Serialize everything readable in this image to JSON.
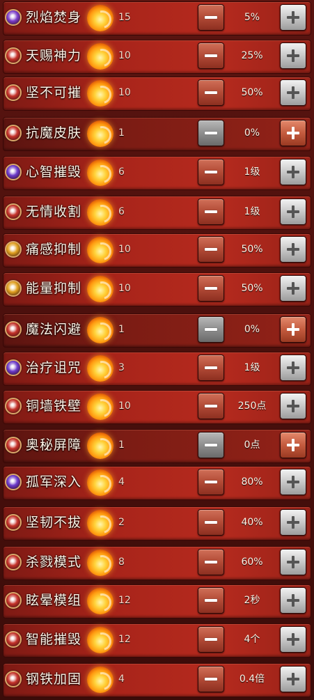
{
  "skills": [
    {
      "name": "烈焰焚身",
      "level": "15",
      "value": "5%",
      "icon_color": "#7a3cc8",
      "icon": "purple-orb-icon",
      "at_min": false
    },
    {
      "name": "天赐神力",
      "level": "10",
      "value": "25%",
      "icon_color": "#c4322a",
      "icon": "muscle-icon",
      "at_min": false
    },
    {
      "name": "坚不可摧",
      "level": "10",
      "value": "50%",
      "icon_color": "#c4322a",
      "icon": "shield-icon",
      "at_min": false
    },
    {
      "name": "抗魔皮肤",
      "level": "1",
      "value": "0%",
      "icon_color": "#c4322a",
      "icon": "shield-icon",
      "at_min": true
    },
    {
      "name": "心智摧毁",
      "level": "6",
      "value": "1级",
      "icon_color": "#6a38c8",
      "icon": "purple-orb-icon",
      "at_min": false
    },
    {
      "name": "无情收割",
      "level": "6",
      "value": "1级",
      "icon_color": "#c4322a",
      "icon": "claw-icon",
      "at_min": false
    },
    {
      "name": "痛感抑制",
      "level": "10",
      "value": "50%",
      "icon_color": "#e0a020",
      "icon": "gold-orb-icon",
      "at_min": false
    },
    {
      "name": "能量抑制",
      "level": "10",
      "value": "50%",
      "icon_color": "#e0a020",
      "icon": "mp-orb-icon",
      "at_min": false
    },
    {
      "name": "魔法闪避",
      "level": "1",
      "value": "0%",
      "icon_color": "#c4322a",
      "icon": "dodge-icon",
      "at_min": true
    },
    {
      "name": "治疗诅咒",
      "level": "3",
      "value": "1级",
      "icon_color": "#6a38c8",
      "icon": "purple-orb-icon",
      "at_min": false
    },
    {
      "name": "铜墙铁壁",
      "level": "10",
      "value": "250点",
      "icon_color": "#c4322a",
      "icon": "shield-icon",
      "at_min": false
    },
    {
      "name": "奥秘屏障",
      "level": "1",
      "value": "0点",
      "icon_color": "#c4322a",
      "icon": "shield-icon",
      "at_min": true
    },
    {
      "name": "孤军深入",
      "level": "4",
      "value": "80%",
      "icon_color": "#6a38c8",
      "icon": "purple-orb-icon",
      "at_min": false
    },
    {
      "name": "坚韧不拔",
      "level": "2",
      "value": "40%",
      "icon_color": "#c4322a",
      "icon": "fist-icon",
      "at_min": false
    },
    {
      "name": "杀戮模式",
      "level": "8",
      "value": "60%",
      "icon_color": "#c4322a",
      "icon": "rage-icon",
      "at_min": false
    },
    {
      "name": "眩晕模组",
      "level": "12",
      "value": "2秒",
      "icon_color": "#c4322a",
      "icon": "stun-icon",
      "at_min": false
    },
    {
      "name": "智能摧毁",
      "level": "12",
      "value": "4个",
      "icon_color": "#c4322a",
      "icon": "bird-icon",
      "at_min": false
    },
    {
      "name": "钢铁加固",
      "level": "4",
      "value": "0.4倍",
      "icon_color": "#c4322a",
      "icon": "armor-icon",
      "at_min": false
    }
  ]
}
